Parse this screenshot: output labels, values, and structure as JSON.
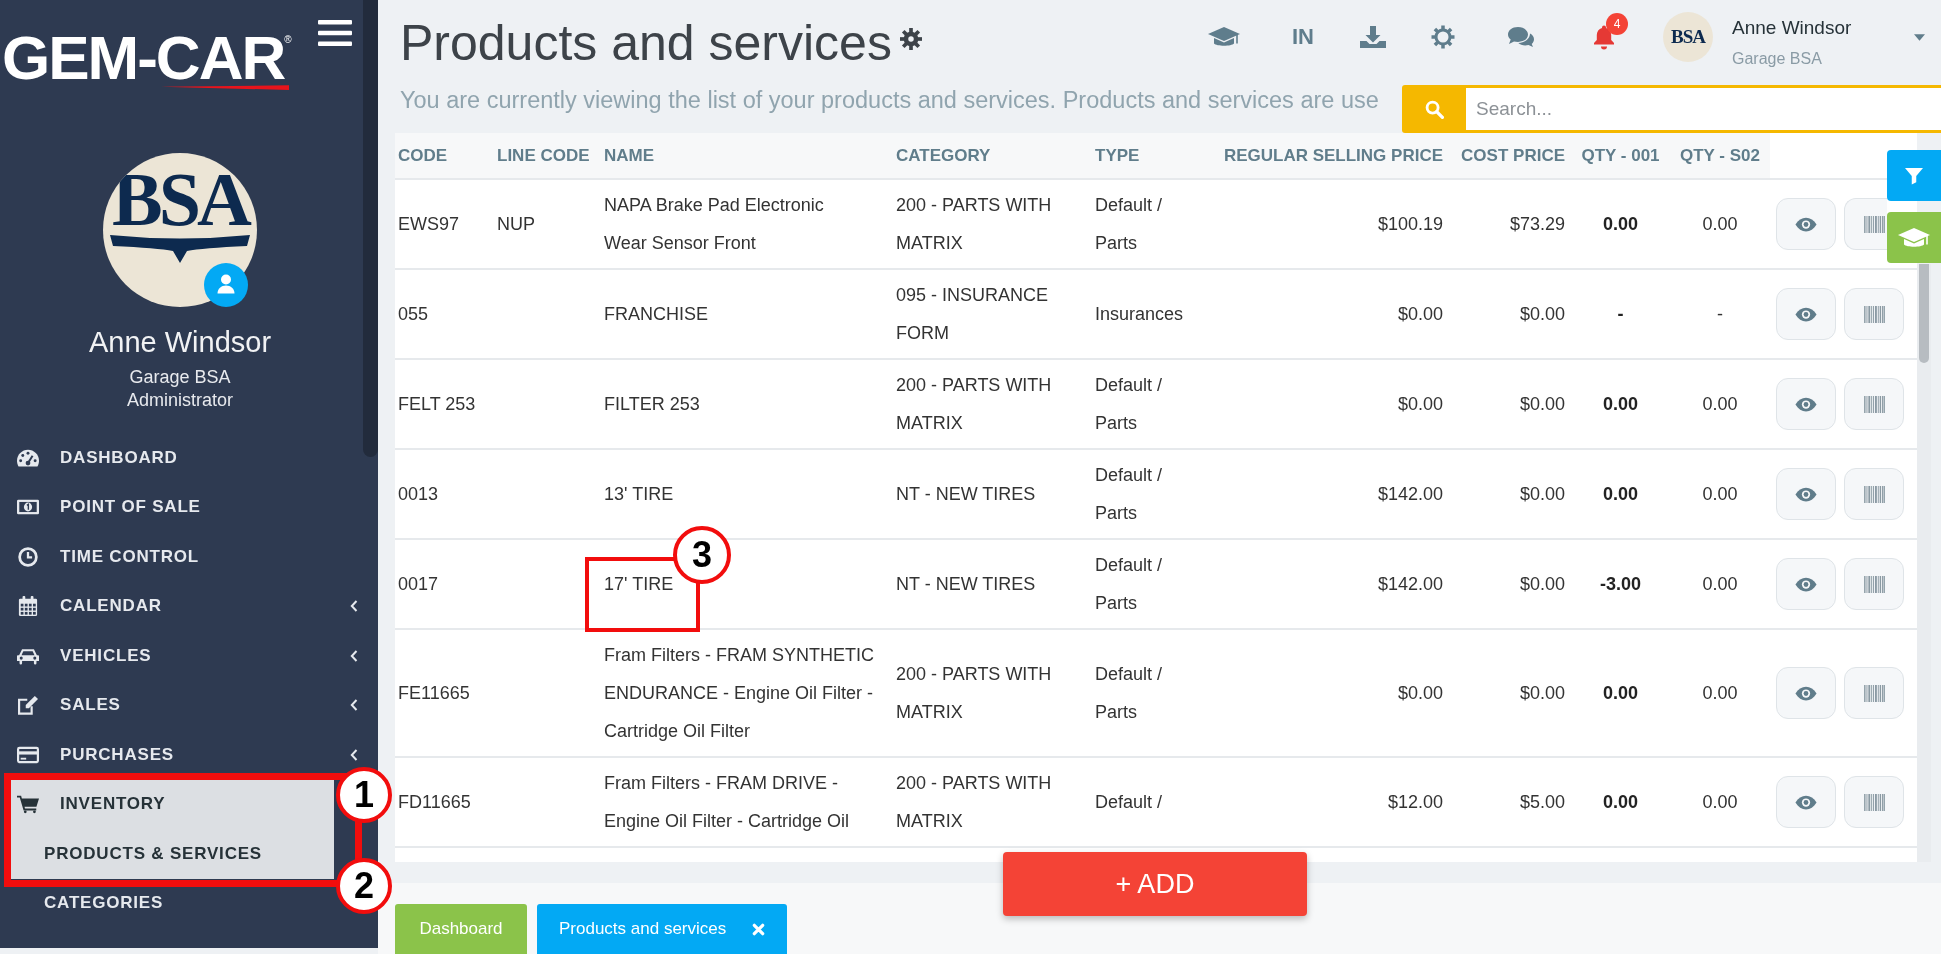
{
  "sidebar": {
    "logo": "GEM-CAR$^{®}$",
    "avatar_text": "BSA",
    "user": {
      "name": "Anne Windsor",
      "company": "Garage BSA",
      "role": "Administrator"
    },
    "menu": [
      {
        "label": "DASHBOARD",
        "selected": false,
        "chevron": false
      },
      {
        "label": "POINT OF SALE",
        "selected": false,
        "chevron": false
      },
      {
        "label": "TIME CONTROL",
        "selected": false,
        "chevron": false
      },
      {
        "label": "CALENDAR",
        "selected": false,
        "chevron": true
      },
      {
        "label": "VEHICLES",
        "selected": false,
        "chevron": true
      },
      {
        "label": "SALES",
        "selected": false,
        "chevron": true
      },
      {
        "label": "PURCHASES",
        "selected": false,
        "chevron": true
      },
      {
        "label": "INVENTORY",
        "selected": true,
        "chevron": false,
        "children": [
          {
            "label": "PRODUCTS & SERVICES",
            "selected": true
          },
          {
            "label": "CATEGORIES",
            "selected": false
          }
        ]
      }
    ]
  },
  "header": {
    "title": "Products and services",
    "subtitle": "You are currently viewing the list of your products and services. Products and services are use",
    "language": "IN",
    "notifications": "4",
    "user": {
      "avatar_text": "BSA",
      "name": "Anne Windsor",
      "company": "Garage BSA"
    }
  },
  "search": {
    "placeholder": "Search..."
  },
  "table": {
    "columns": [
      "CODE",
      "LINE CODE",
      "NAME",
      "CATEGORY",
      "TYPE",
      "REGULAR SELLING PRICE",
      "COST PRICE",
      "QTY - 001",
      "QTY - S02"
    ],
    "rows": [
      {
        "code": "EWS97",
        "line_code": "NUP",
        "name": "NAPA Brake Pad Electronic\nWear Sensor Front",
        "category": "200 - PARTS WITH\nMATRIX",
        "type": "Default /\nParts",
        "price": "$100.19",
        "cost": "$73.29",
        "qty_001": "0.00",
        "qty_s02": "0.00"
      },
      {
        "code": "055",
        "name": "FRANCHISE",
        "category": "095 - INSURANCE\nFORM",
        "type": "Insurances",
        "price": "$0.00",
        "cost": "$0.00",
        "qty_001": "-",
        "qty_s02": "-"
      },
      {
        "code": "FELT 253",
        "name": "FILTER 253",
        "category": "200 - PARTS WITH\nMATRIX",
        "type": "Default /\nParts",
        "price": "$0.00",
        "cost": "$0.00",
        "qty_001": "0.00",
        "qty_s02": "0.00"
      },
      {
        "code": "0013",
        "name": "13' TIRE",
        "category": "NT - NEW TIRES",
        "type": "Default /\nParts",
        "price": "$142.00",
        "cost": "$0.00",
        "qty_001": "0.00",
        "qty_s02": "0.00"
      },
      {
        "code": "0017",
        "name": "17' TIRE",
        "category": "NT - NEW TIRES",
        "type": "Default /\nParts",
        "price": "$142.00",
        "cost": "$0.00",
        "qty_001": "-3.00",
        "qty_s02": "0.00"
      },
      {
        "code": "FE11665",
        "name": "Fram Filters - FRAM SYNTHETIC\nENDURANCE - Engine Oil Filter -\nCartridge Oil Filter",
        "category": "200 - PARTS WITH\nMATRIX",
        "type": "Default /\nParts",
        "price": "$0.00",
        "cost": "$0.00",
        "qty_001": "0.00",
        "qty_s02": "0.00"
      },
      {
        "code": "FD11665",
        "name": "Fram Filters - FRAM DRIVE -\nEngine Oil Filter - Cartridge Oil",
        "category": "200 - PARTS WITH\nMATRIX",
        "type": "Default /",
        "price": "$12.00",
        "cost": "$5.00",
        "qty_001": "0.00",
        "qty_s02": "0.00"
      }
    ]
  },
  "add_button": "+ ADD",
  "tabs": [
    {
      "label": "Dashboard",
      "color": "#8bc34a",
      "closable": false
    },
    {
      "label": "Products and services",
      "color": "#03a9f4",
      "closable": true
    }
  ],
  "annotations": [
    {
      "marker": "1"
    },
    {
      "marker": "2"
    },
    {
      "marker": "3"
    }
  ]
}
